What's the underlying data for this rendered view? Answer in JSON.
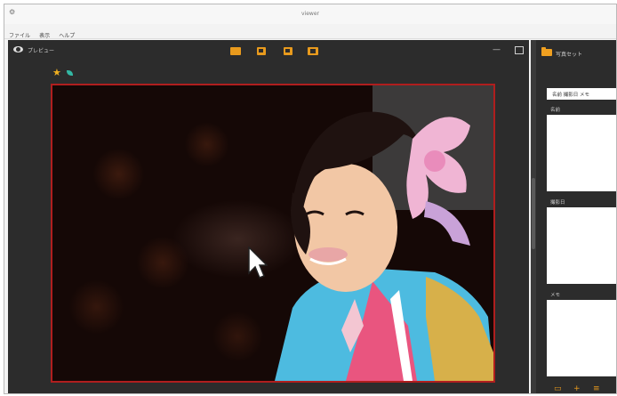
{
  "window": {
    "app_icon": "app-icon",
    "title": "viewer"
  },
  "menu": {
    "items": [
      "ファイル",
      "表示",
      "ヘルプ"
    ]
  },
  "viewer": {
    "title": "プレビュー",
    "toolbar_icons": [
      "grid-view-icon",
      "rotate-left-icon",
      "rotate-right-icon",
      "fit-screen-icon"
    ],
    "window_controls": {
      "minimize": "—"
    },
    "tag_icons": [
      "star-icon",
      "leaf-icon"
    ],
    "accent": "#e89a1d",
    "frame_color": "#b01e1e"
  },
  "side_panel": {
    "title": "写真セット",
    "search_value": "名前 撮影日 メモ",
    "sections": [
      {
        "label": "名前"
      },
      {
        "label": "撮影日"
      },
      {
        "label": "メモ"
      }
    ],
    "bottom_icons": [
      "camera-icon",
      "add-icon",
      "list-icon"
    ]
  }
}
